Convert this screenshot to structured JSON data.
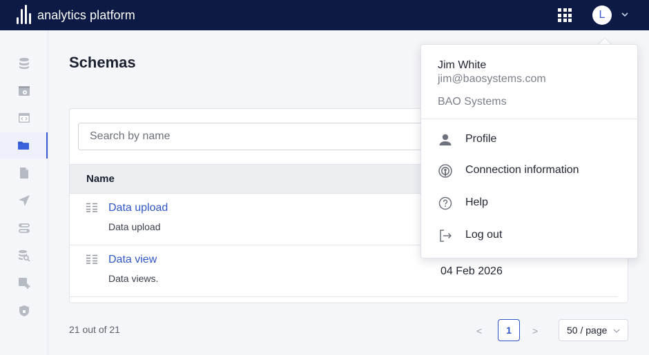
{
  "app": {
    "brand": "analytics platform",
    "avatar_initial": "L"
  },
  "sidebar": {
    "items": [
      {
        "icon": "database-icon",
        "active": false
      },
      {
        "icon": "data-view-icon",
        "active": false
      },
      {
        "icon": "code-window-icon",
        "active": false
      },
      {
        "icon": "folder-icon",
        "active": true
      },
      {
        "icon": "document-icon",
        "active": false
      },
      {
        "icon": "send-icon",
        "active": false
      },
      {
        "icon": "pipeline-icon",
        "active": false
      },
      {
        "icon": "database-search-icon",
        "active": false
      },
      {
        "icon": "add-widget-icon",
        "active": false
      },
      {
        "icon": "shield-icon",
        "active": false
      }
    ]
  },
  "main": {
    "title": "Schemas",
    "search": {
      "placeholder": "Search by name",
      "value": ""
    },
    "table": {
      "columns": [
        "Name"
      ],
      "rows": [
        {
          "title": "Data upload",
          "description": "Data upload",
          "date": ""
        },
        {
          "title": "Data view",
          "description": "Data views.",
          "date": "04 Feb 2026"
        }
      ]
    },
    "footer": {
      "count": "21 out of 21",
      "prev": "<",
      "page": "1",
      "next": ">",
      "per_page": "50 / page"
    }
  },
  "user_menu": {
    "name": "Jim White",
    "email": "jim@baosystems.com",
    "organization": "BAO Systems",
    "items": [
      {
        "label": "Profile",
        "icon": "user-icon"
      },
      {
        "label": "Connection information",
        "icon": "broadcast-icon"
      },
      {
        "label": "Help",
        "icon": "help-circle-icon"
      },
      {
        "label": "Log out",
        "icon": "logout-icon"
      }
    ]
  },
  "colors": {
    "topbar": "#0d1a45",
    "accent": "#2f55c9",
    "icon_gray": "#b6bac3"
  }
}
